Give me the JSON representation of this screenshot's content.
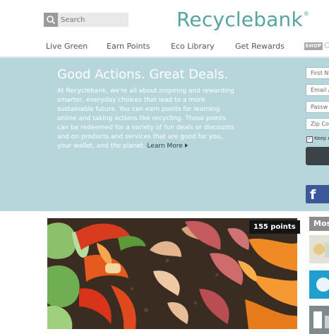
{
  "search": {
    "placeholder": "Search",
    "icon": "search-icon"
  },
  "brand": {
    "name": "Recyclebank",
    "mark": "®",
    "color": "#56a3a2"
  },
  "nav": {
    "items": [
      "Live Green",
      "Earn Points",
      "Eco Library",
      "Get Rewards"
    ],
    "shop_badge": "SHOP",
    "shop_label_partial": "O"
  },
  "hero": {
    "title": "Good Actions. Great Deals.",
    "text": "At Recyclebank, we're all about inspiring and rewarding smarter, everyday choices that lead to a more sustainable future. You can earn points for learning online and taking actions like recycling. Those points can be redeemed for a variety of fun deals or discounts and on products and services that are good for you, your wallet, and the planet.",
    "learn_more": "Learn More",
    "background": "#b7d6db"
  },
  "signup": {
    "fields": [
      "First N",
      "Email A",
      "Passw",
      "Zip Co"
    ],
    "keep_label": "Keep m",
    "keep_checked": "✓",
    "facebook_glyph": "f"
  },
  "feature": {
    "points": "155 points"
  },
  "side": {
    "heading": "Mos"
  },
  "colors": {
    "accent": "#56a3a2",
    "facebook": "#3b5998",
    "hero": "#b7d6db"
  }
}
